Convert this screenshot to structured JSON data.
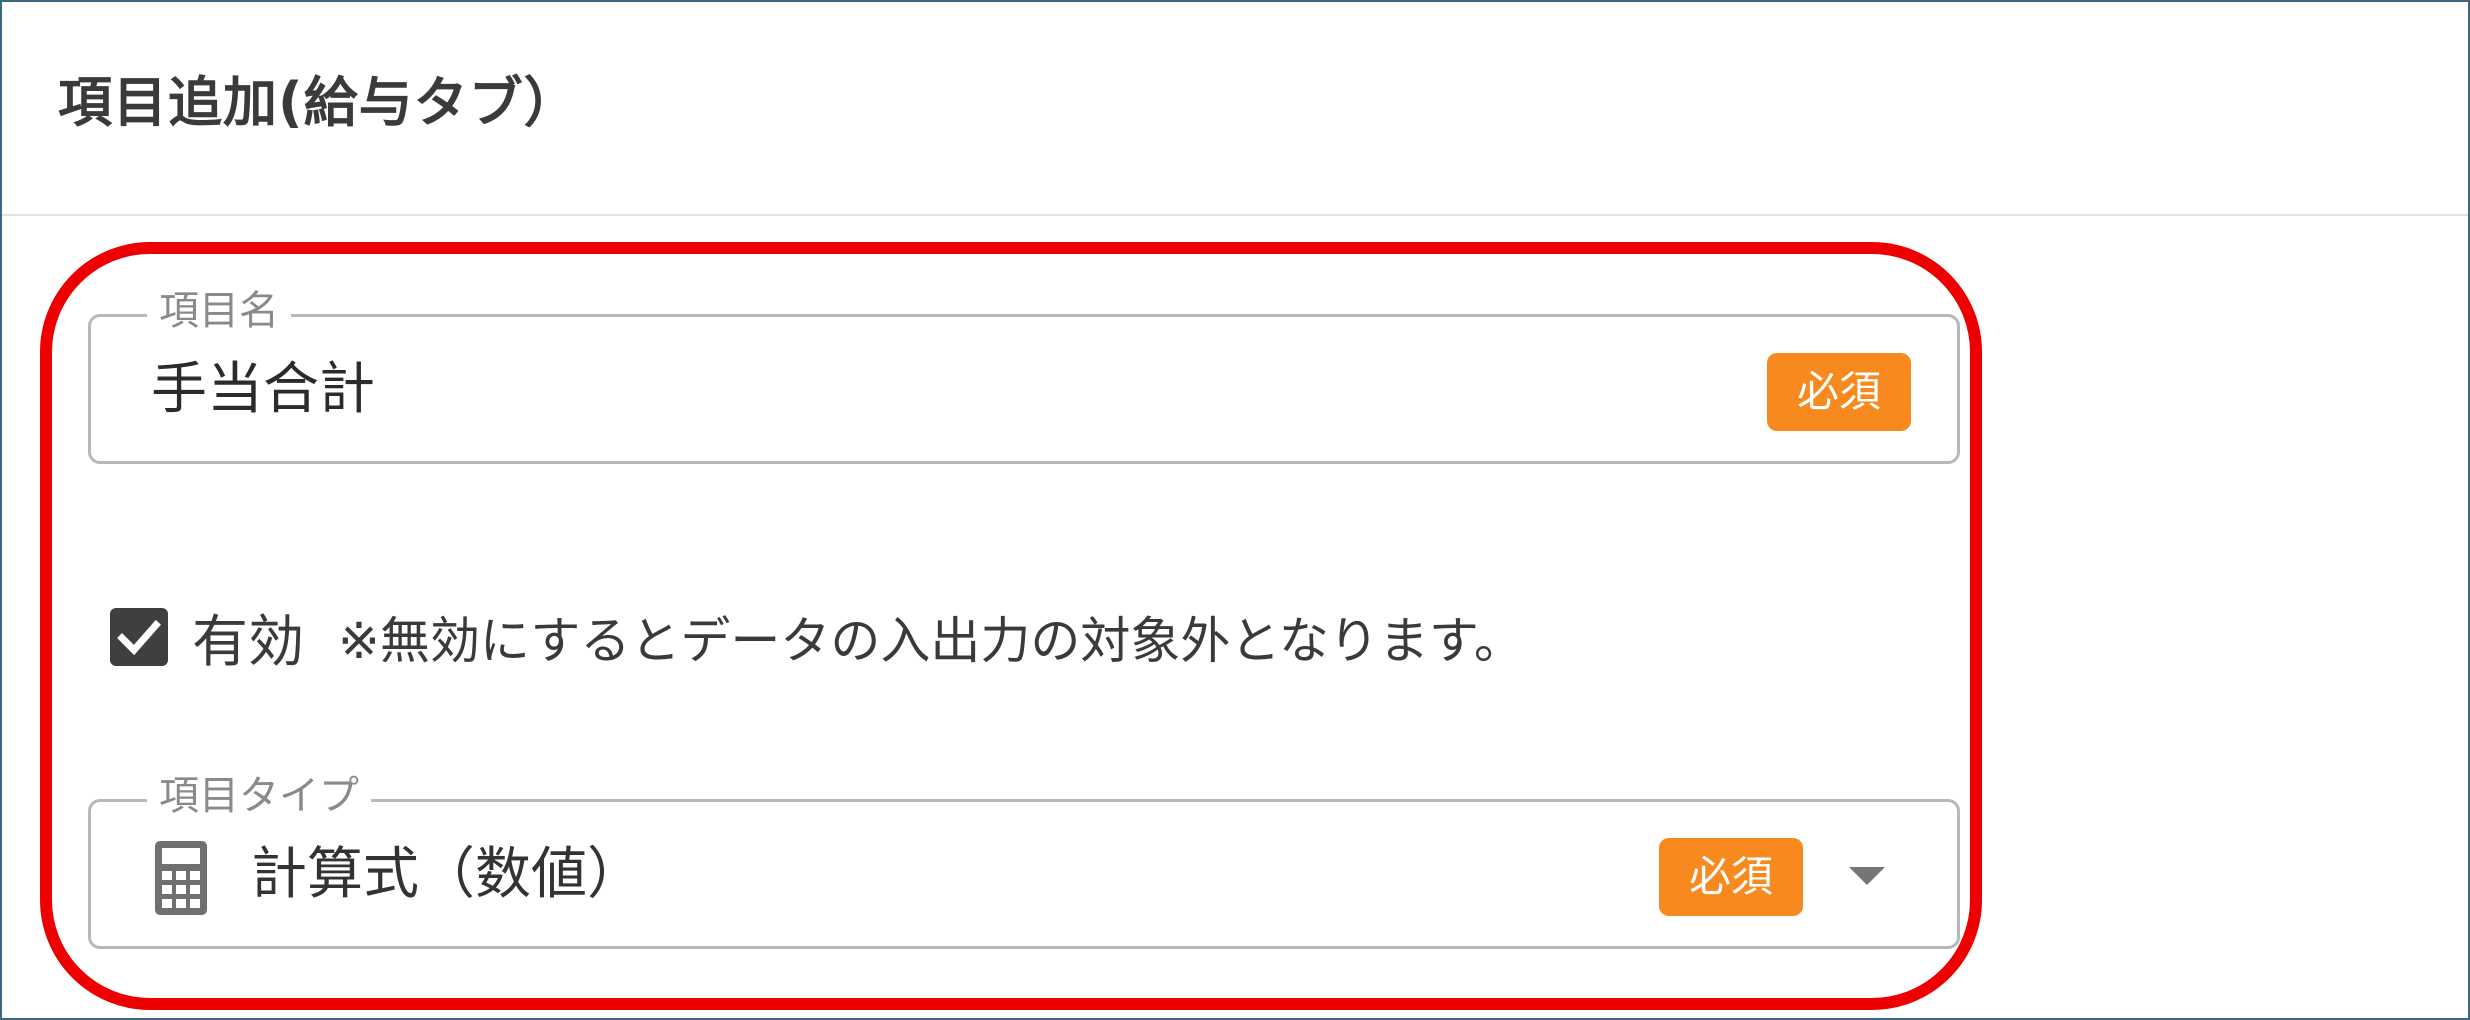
{
  "dialog": {
    "title": "項目追加(給与タブ）"
  },
  "item_name_field": {
    "label": "項目名",
    "value": "手当合計",
    "required_badge": "必須"
  },
  "enabled_checkbox": {
    "checked": true,
    "label": "有効",
    "note": "※無効にするとデータの入出力の対象外となります。"
  },
  "item_type_field": {
    "label": "項目タイプ",
    "value": "計算式（数値）",
    "icon": "calculator-icon",
    "required_badge": "必須"
  },
  "colors": {
    "highlight_border": "#ee0000",
    "badge_background": "#f7891f",
    "frame_border": "#3d6680"
  }
}
